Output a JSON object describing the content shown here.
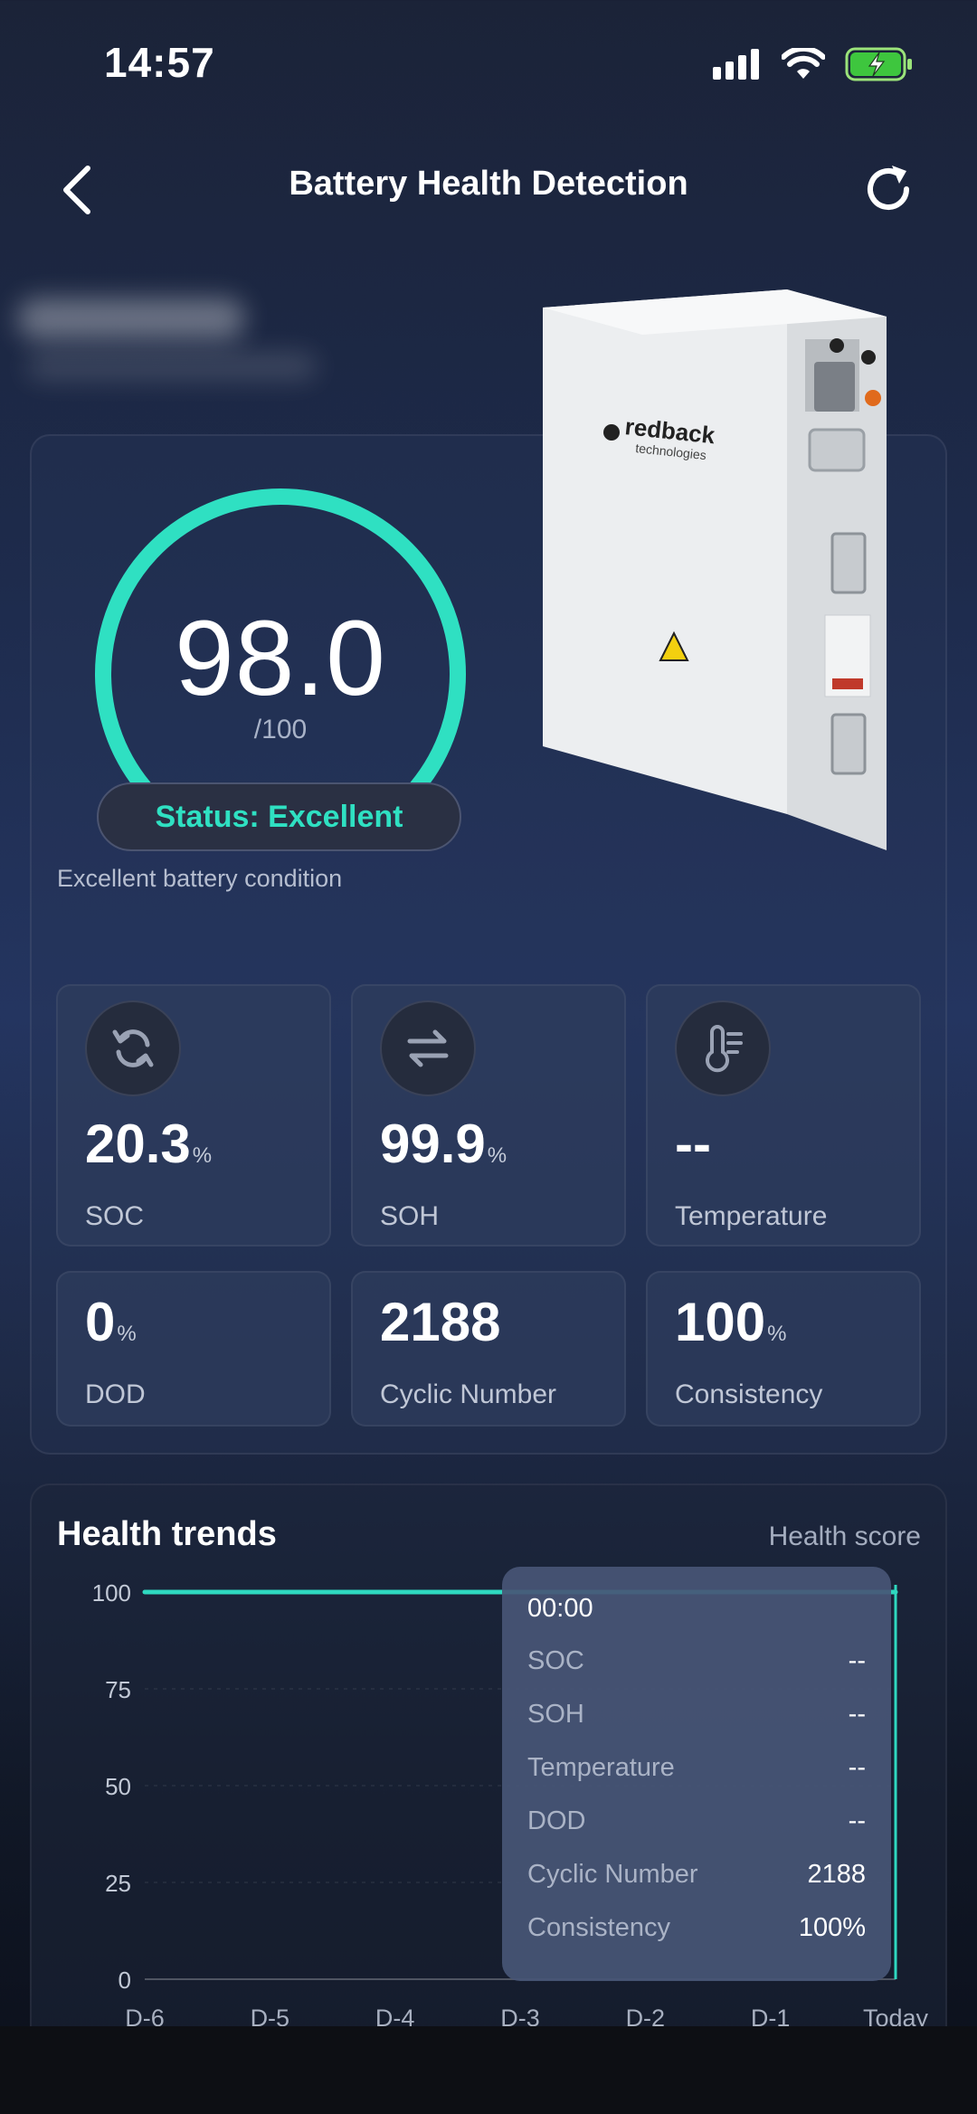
{
  "status_bar": {
    "time": "14:57"
  },
  "nav": {
    "title": "Battery Health Detection"
  },
  "gauge": {
    "value": "98.0",
    "max_label": "/100",
    "fraction": 0.98,
    "status": "Status: Excellent",
    "condition": "Excellent battery condition"
  },
  "product": {
    "brand_line1": "redback",
    "brand_line2": "technologies"
  },
  "metrics": [
    {
      "value": "20.3",
      "unit": "%",
      "label": "SOC",
      "icon": "refresh-icon"
    },
    {
      "value": "99.9",
      "unit": "%",
      "label": "SOH",
      "icon": "swap-icon"
    },
    {
      "value": "--",
      "unit": "",
      "label": "Temperature",
      "icon": "thermometer-icon"
    },
    {
      "value": "0",
      "unit": "%",
      "label": "DOD"
    },
    {
      "value": "2188",
      "unit": "",
      "label": "Cyclic Number"
    },
    {
      "value": "100",
      "unit": "%",
      "label": "Consistency"
    }
  ],
  "trend": {
    "title": "Health trends",
    "legend": "Health score",
    "tooltip": {
      "time": "00:00",
      "rows": [
        {
          "k": "SOC",
          "v": "--"
        },
        {
          "k": "SOH",
          "v": "--"
        },
        {
          "k": "Temperature",
          "v": "--"
        },
        {
          "k": "DOD",
          "v": "--"
        },
        {
          "k": "Cyclic Number",
          "v": "2188"
        },
        {
          "k": "Consistency",
          "v": "100%"
        }
      ]
    }
  },
  "chart_data": {
    "type": "line",
    "categories": [
      "D-6",
      "D-5",
      "D-4",
      "D-3",
      "D-2",
      "D-1",
      "Today"
    ],
    "series": [
      {
        "values": [
          100,
          100,
          100,
          100,
          100,
          100,
          100
        ]
      }
    ],
    "ylim": [
      0,
      100
    ],
    "yticks": [
      "100",
      "75",
      "50",
      "25",
      "0"
    ],
    "color": "#2fd8c0"
  }
}
